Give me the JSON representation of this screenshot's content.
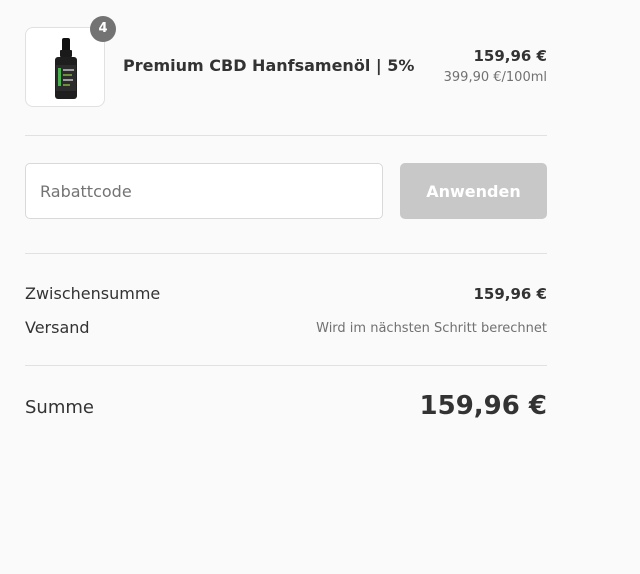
{
  "product": {
    "quantity": "4",
    "name": "Premium CBD Hanfsamenöl | 5%",
    "price": "159,96 €",
    "unit_price": "399,90 €/100ml",
    "image_icon": "cbd-oil-bottle"
  },
  "discount": {
    "placeholder": "Rabattcode",
    "value": "",
    "apply_label": "Anwenden"
  },
  "totals": {
    "subtotal_label": "Zwischensumme",
    "subtotal_value": "159,96 €",
    "shipping_label": "Versand",
    "shipping_value": "Wird im nächsten Schritt berechnet",
    "total_label": "Summe",
    "total_value": "159,96 €"
  },
  "colors": {
    "background": "#fafafa",
    "text": "#333333",
    "muted_text": "#717171",
    "badge": "#737373",
    "button_disabled": "#c8c8c8",
    "border": "#e1e1e1"
  }
}
